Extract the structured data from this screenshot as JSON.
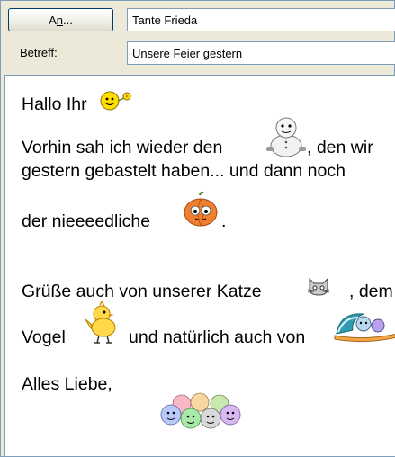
{
  "header": {
    "to_button_pre": "A",
    "to_button_underline": "n",
    "to_button_post": "...",
    "to_value": "Tante Frieda",
    "subject_label_pre": "Bet",
    "subject_label_underline": "r",
    "subject_label_post": "eff:",
    "subject_value": "Unsere Feier gestern"
  },
  "message": {
    "line1": "Hallo Ihr",
    "line2a": "Vorhin sah ich wieder den",
    "line2b": ", den wir",
    "line3": "gestern gebastelt haben... und dann noch",
    "line4a": "der nieeeedliche",
    "line4b": ".",
    "line5a": "Grüße auch von unserer Katze",
    "line5b": ", dem",
    "line6a": "Vogel",
    "line6b": "und natürlich auch von",
    "line7": "Alles Liebe,"
  },
  "emoticons": {
    "greeting": "smiley-with-flower-icon",
    "snowman": "snowman-icon",
    "pumpkin": "pumpkin-icon",
    "cat": "cat-icon",
    "bird": "yellow-bird-icon",
    "wave": "surfing-smiley-icon",
    "group": "smiley-group-icon"
  },
  "colors": {
    "window_bg": "#ece9d8",
    "border": "#7f9db9",
    "button_border": "#003c74",
    "smiley_yellow": "#ffde00"
  }
}
